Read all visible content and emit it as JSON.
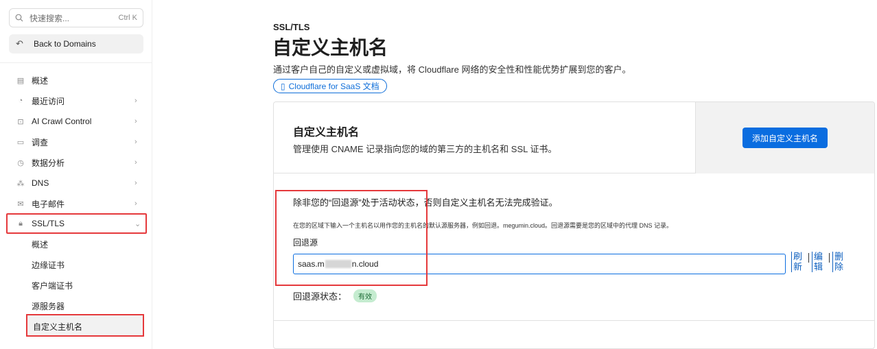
{
  "sidebar": {
    "search_placeholder": "快速搜索...",
    "search_shortcut": "Ctrl K",
    "back_label": "Back to Domains",
    "items": [
      {
        "label": "概述",
        "icon": "document-icon",
        "chevron": ""
      },
      {
        "label": "最近访问",
        "icon": "clock-history-icon",
        "chevron": "›"
      },
      {
        "label": "AI Crawl Control",
        "icon": "robot-icon",
        "chevron": "›"
      },
      {
        "label": "调查",
        "icon": "investigate-icon",
        "chevron": "›"
      },
      {
        "label": "数据分析",
        "icon": "chart-pie-icon",
        "chevron": "›"
      },
      {
        "label": "DNS",
        "icon": "network-icon",
        "chevron": "›"
      },
      {
        "label": "电子邮件",
        "icon": "mail-icon",
        "chevron": "›"
      },
      {
        "label": "SSL/TLS",
        "icon": "lock-icon",
        "chevron": "⌄"
      }
    ],
    "sub_items": [
      "概述",
      "边缘证书",
      "客户端证书",
      "源服务器"
    ],
    "sub_current": "自定义主机名"
  },
  "main": {
    "breadcrumb": "SSL/TLS",
    "title": "自定义主机名",
    "description": "通过客户自己的自定义或虚拟域，将 Cloudflare 网络的安全性和性能优势扩展到您的客户。",
    "doc_link": "Cloudflare for SaaS 文档",
    "card": {
      "title": "自定义主机名",
      "subtitle": "管理使用 CNAME 记录指向您的域的第三方的主机名和 SSL 证书。",
      "add_button": "添加自定义主机名",
      "warning": "除非您的“回退源”处于活动状态，否则自定义主机名无法完成验证。",
      "hint": "在您的区域下输入一个主机名以用作您的主机名的默认源服务器，例如回退。megumin.cloud。回退源需要是您的区域中的代理 DNS 记录。",
      "fallback_label": "回退源",
      "fallback_value_prefix": "saas.m",
      "fallback_value_suffix": "n.cloud",
      "actions": [
        "刷新",
        "编辑",
        "删除"
      ],
      "status_label": "回退源状态：",
      "status_value": "有效"
    }
  },
  "colors": {
    "accent": "#0a6de0",
    "highlight_border": "#e5383b",
    "badge_bg": "#c5ecd0"
  }
}
